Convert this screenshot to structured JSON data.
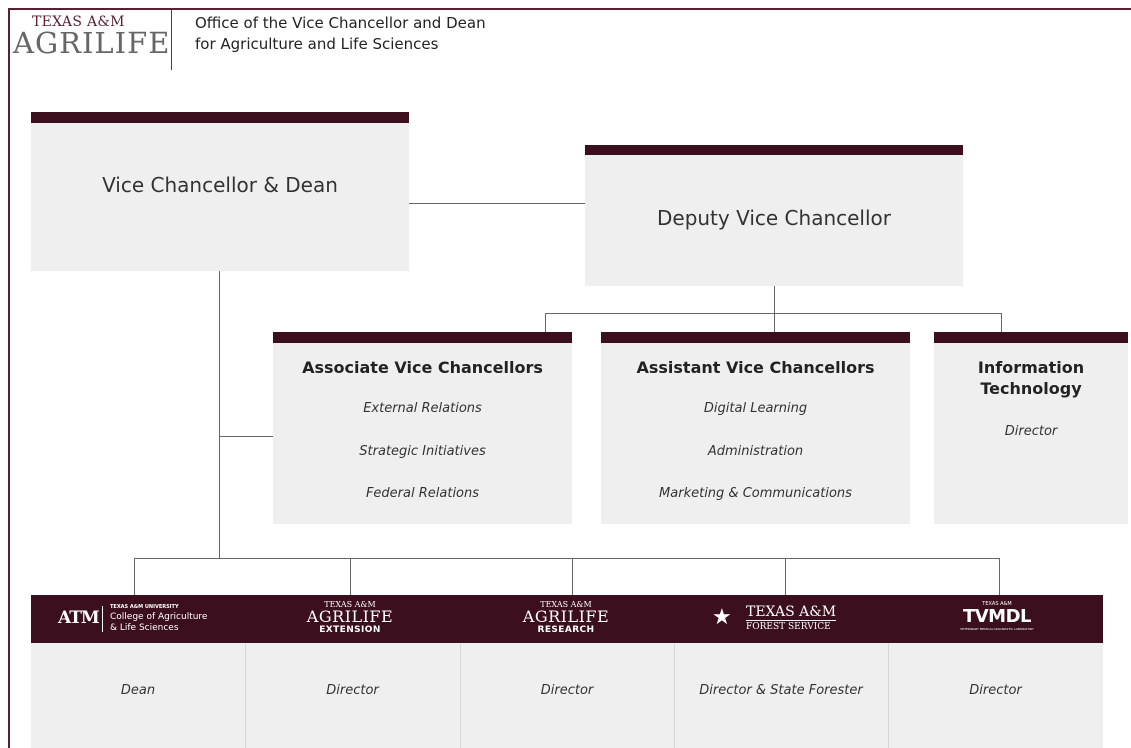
{
  "header": {
    "logo_top": "TEXAS A&M",
    "logo_main": "AGRILIFE",
    "title_line1": "Office of the Vice Chancellor and Dean",
    "title_line2": "for Agriculture and Life Sciences"
  },
  "top_nodes": {
    "vice_chancellor": "Vice Chancellor & Dean",
    "deputy": "Deputy Vice Chancellor"
  },
  "groups": [
    {
      "title": "Associate Vice Chancellors",
      "items": [
        "External Relations",
        "Strategic Initiatives",
        "Federal Relations"
      ]
    },
    {
      "title": "Assistant Vice Chancellors",
      "items": [
        "Digital Learning",
        "Administration",
        "Marketing & Communications"
      ]
    },
    {
      "title": "Information Technology",
      "items": [
        "Director"
      ]
    }
  ],
  "units": [
    {
      "logo_small": "TEXAS A&M UNIVERSITY",
      "logo_line1": "College of Agriculture",
      "logo_line2": "& Life Sciences",
      "logo_mark": "ATM",
      "role": "Dean"
    },
    {
      "logo_small": "TEXAS A&M",
      "logo_main": "AGRILIFE",
      "logo_sub": "EXTENSION",
      "role": "Director"
    },
    {
      "logo_small": "TEXAS A&M",
      "logo_main": "AGRILIFE",
      "logo_sub": "RESEARCH",
      "role": "Director"
    },
    {
      "logo_main": "TEXAS A&M",
      "logo_sub": "FOREST SERVICE",
      "role": "Director & State Forester"
    },
    {
      "logo_small": "TEXAS A&M",
      "logo_main": "TVMDL",
      "logo_sub": "VETERINARY MEDICAL DIAGNOSTIC LABORATORY",
      "role": "Director"
    }
  ],
  "colors": {
    "maroon_bar": "#3c0f1e",
    "box_fill": "#efefef",
    "connector": "#666666"
  }
}
